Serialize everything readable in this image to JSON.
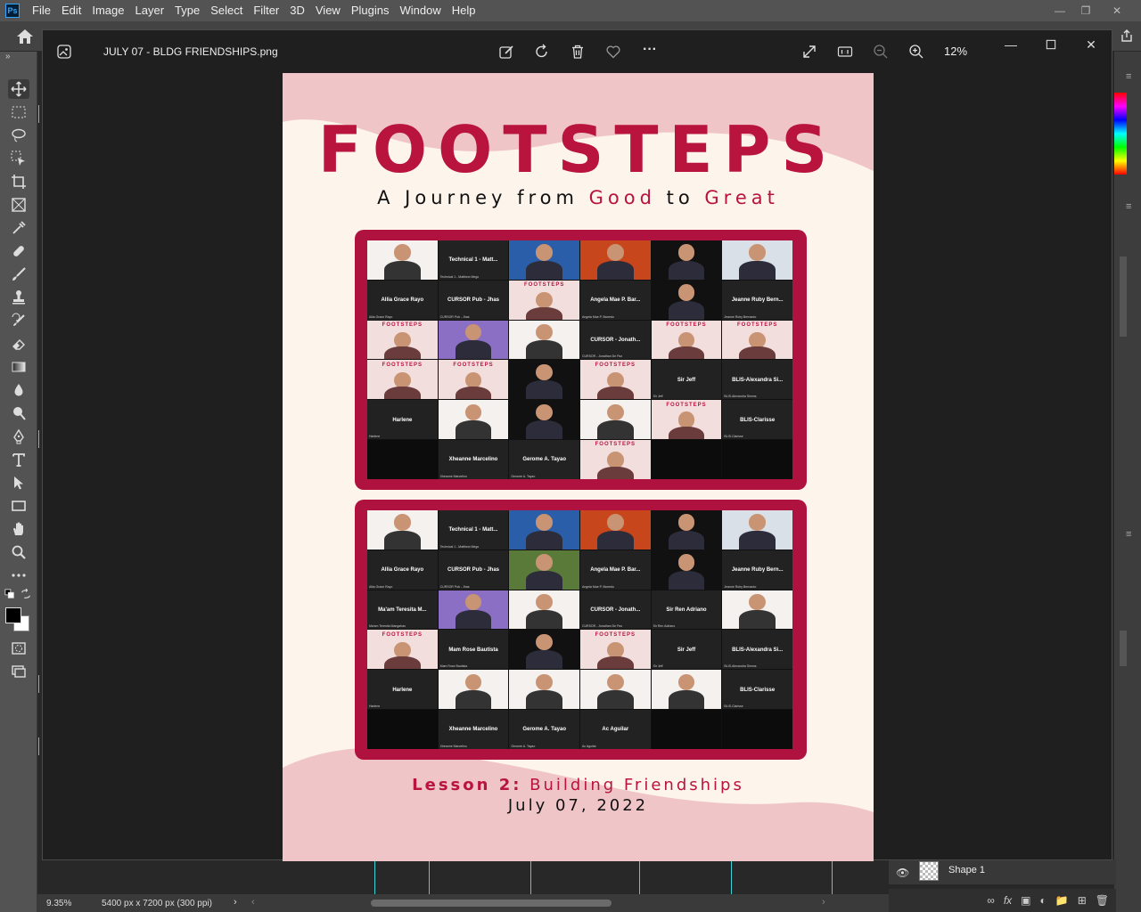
{
  "app": {
    "logo": "Ps",
    "menu": [
      "File",
      "Edit",
      "Image",
      "Layer",
      "Type",
      "Select",
      "Filter",
      "3D",
      "View",
      "Plugins",
      "Window",
      "Help"
    ]
  },
  "status": {
    "zoom": "9.35%",
    "doc_size": "5400 px x 7200 px (300 ppi)"
  },
  "layers": {
    "items": [
      {
        "name": "Shape 1",
        "visible": true
      }
    ]
  },
  "viewer": {
    "file_name": "JULY 07 - BLDG FRIENDSHIPS.png",
    "zoom": "12%",
    "more_label": "···"
  },
  "poster": {
    "title": "FOOTSTEPS",
    "subtitle_a": "A Journey from ",
    "subtitle_good": "Good",
    "subtitle_to": " to ",
    "subtitle_great": "Great",
    "lesson_prefix": "Lesson 2:",
    "lesson_title": " Building Friendships",
    "date": "July 07, 2022",
    "footsteps_label": "FOOTSTEPS",
    "screenshot_1_tiles": [
      {
        "type": "cam",
        "style": "white",
        "cap": ""
      },
      {
        "type": "name",
        "name": "Technical 1 - Matt...",
        "cap": "Technical 1 - Matthew Mego"
      },
      {
        "type": "cam",
        "style": "blue",
        "cap": ""
      },
      {
        "type": "cam",
        "style": "orange",
        "cap": ""
      },
      {
        "type": "cam",
        "style": "dark",
        "cap": ""
      },
      {
        "type": "cam",
        "style": "pale",
        "cap": ""
      },
      {
        "type": "name",
        "name": "Allia Grace Rayo",
        "cap": "Allia Grace Rayo"
      },
      {
        "type": "name",
        "name": "CURSOR Pub - Jhas",
        "cap": "CURSOR Pub - Jhas"
      },
      {
        "type": "fs",
        "cap": ""
      },
      {
        "type": "name",
        "name": "Angela Mae P. Bar...",
        "cap": "Angela Mae P. Barredo"
      },
      {
        "type": "cam",
        "style": "dark",
        "cap": ""
      },
      {
        "type": "name",
        "name": "Jeanne Ruby Bern...",
        "cap": "Jeanne Ruby Bernardo"
      },
      {
        "type": "fs",
        "cap": ""
      },
      {
        "type": "cam",
        "style": "purple",
        "cap": ""
      },
      {
        "type": "cam",
        "style": "white",
        "cap": ""
      },
      {
        "type": "name",
        "name": "CURSOR - Jonath...",
        "cap": "CURSOR - Jonathan De Paz"
      },
      {
        "type": "fs",
        "cap": ""
      },
      {
        "type": "fs",
        "cap": ""
      },
      {
        "type": "fs",
        "cap": ""
      },
      {
        "type": "fs",
        "cap": ""
      },
      {
        "type": "cam",
        "style": "dark",
        "cap": ""
      },
      {
        "type": "fs",
        "cap": ""
      },
      {
        "type": "name",
        "name": "Sir Jeff",
        "cap": "Sir Jeff"
      },
      {
        "type": "name",
        "name": "BLIS-Alexandra Si...",
        "cap": "BLIS-Alexandra Simms"
      },
      {
        "type": "name",
        "name": "Harlene",
        "cap": "Harlene"
      },
      {
        "type": "cam",
        "style": "white",
        "cap": ""
      },
      {
        "type": "cam",
        "style": "dark",
        "cap": ""
      },
      {
        "type": "cam",
        "style": "white",
        "cap": ""
      },
      {
        "type": "fs",
        "cap": ""
      },
      {
        "type": "name",
        "name": "BLIS-Clarisse",
        "cap": "BLIS-Clarisse"
      },
      {
        "type": "empty",
        "cap": ""
      },
      {
        "type": "name",
        "name": "Xheanne Marcelino",
        "cap": "Xheanne Marcelino"
      },
      {
        "type": "name",
        "name": "Gerome A. Tayao",
        "cap": "Gerome A. Tayao"
      },
      {
        "type": "fs",
        "cap": ""
      },
      {
        "type": "empty",
        "cap": ""
      },
      {
        "type": "empty",
        "cap": ""
      }
    ],
    "screenshot_2_tiles": [
      {
        "type": "cam",
        "style": "white",
        "cap": ""
      },
      {
        "type": "name",
        "name": "Technical 1 - Matt...",
        "cap": "Technical 1 - Matthew Mego"
      },
      {
        "type": "cam",
        "style": "blue",
        "cap": ""
      },
      {
        "type": "cam",
        "style": "orange",
        "cap": ""
      },
      {
        "type": "cam",
        "style": "dark",
        "cap": ""
      },
      {
        "type": "cam",
        "style": "pale",
        "cap": ""
      },
      {
        "type": "name",
        "name": "Allia Grace Rayo",
        "cap": "Allia Grace Rayo"
      },
      {
        "type": "name",
        "name": "CURSOR Pub - Jhas",
        "cap": "CURSOR Pub - Jhas"
      },
      {
        "type": "cam",
        "style": "green",
        "cap": ""
      },
      {
        "type": "name",
        "name": "Angela Mae P. Bar...",
        "cap": "Angela Mae P. Barredo"
      },
      {
        "type": "cam",
        "style": "dark",
        "cap": ""
      },
      {
        "type": "name",
        "name": "Jeanne Ruby Bern...",
        "cap": "Jeanne Ruby Bernardo"
      },
      {
        "type": "name",
        "name": "Ma'am Teresita M...",
        "cap": "Ma'am Teresita Mangahas"
      },
      {
        "type": "cam",
        "style": "purple",
        "cap": ""
      },
      {
        "type": "cam",
        "style": "white",
        "cap": ""
      },
      {
        "type": "name",
        "name": "CURSOR - Jonath...",
        "cap": "CURSOR - Jonathan De Paz"
      },
      {
        "type": "name",
        "name": "Sir Ren Adriano",
        "cap": "Sir Ren Adriano"
      },
      {
        "type": "cam",
        "style": "white",
        "cap": ""
      },
      {
        "type": "fs",
        "cap": ""
      },
      {
        "type": "name",
        "name": "Mam Rose Bautista",
        "cap": "Mam Rose Bautista"
      },
      {
        "type": "cam",
        "style": "dark",
        "cap": ""
      },
      {
        "type": "fs",
        "cap": ""
      },
      {
        "type": "name",
        "name": "Sir Jeff",
        "cap": "Sir Jeff"
      },
      {
        "type": "name",
        "name": "BLIS-Alexandra Si...",
        "cap": "BLIS-Alexandra Simms"
      },
      {
        "type": "name",
        "name": "Harlene",
        "cap": "Harlene"
      },
      {
        "type": "cam",
        "style": "white",
        "cap": ""
      },
      {
        "type": "cam",
        "style": "white",
        "cap": ""
      },
      {
        "type": "cam",
        "style": "white",
        "cap": ""
      },
      {
        "type": "cam",
        "style": "white",
        "cap": ""
      },
      {
        "type": "name",
        "name": "BLIS-Clarisse",
        "cap": "BLIS-Clarisse"
      },
      {
        "type": "empty",
        "cap": ""
      },
      {
        "type": "name",
        "name": "Xheanne Marcelino",
        "cap": "Xheanne Marcelino"
      },
      {
        "type": "name",
        "name": "Gerome A. Tayao",
        "cap": "Gerome A. Tayao"
      },
      {
        "type": "name",
        "name": "Ac Aguilar",
        "cap": "Ac Aguilar"
      },
      {
        "type": "empty",
        "cap": ""
      },
      {
        "type": "empty",
        "cap": ""
      }
    ]
  },
  "colors": {
    "brand_red": "#b8143e",
    "poster_bg": "#fdf4ec",
    "poster_pink": "#efc5c8",
    "frame": "#b0123f",
    "guide": "#36d6d6"
  }
}
